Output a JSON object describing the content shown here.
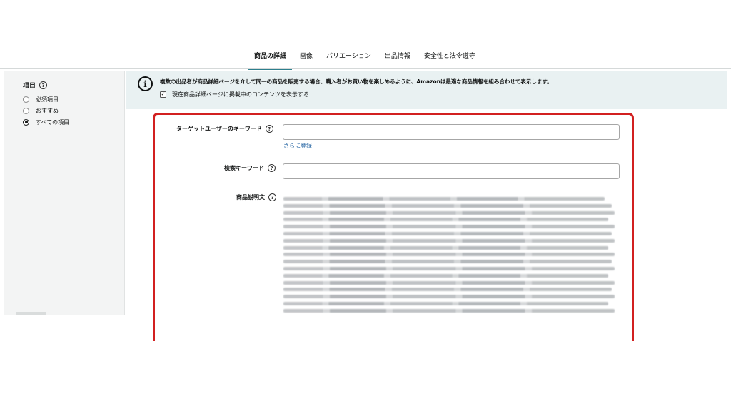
{
  "tabs": [
    {
      "label": "商品の詳細",
      "active": true
    },
    {
      "label": "画像",
      "active": false
    },
    {
      "label": "バリエーション",
      "active": false
    },
    {
      "label": "出品情報",
      "active": false
    },
    {
      "label": "安全性と法令遵守",
      "active": false
    }
  ],
  "sidebar": {
    "title": "項目",
    "options": [
      {
        "label": "必須項目",
        "checked": false
      },
      {
        "label": "おすすめ",
        "checked": false
      },
      {
        "label": "すべての項目",
        "checked": true
      }
    ]
  },
  "banner": {
    "message": "複数の出品者が商品詳細ページを介して同一の商品を販売する場合、購入者がお買い物を楽しめるように、Amazonは最適な商品情報を組み合わせて表示します。",
    "checkbox_label": "現在商品詳細ページに掲載中のコンテンツを表示する",
    "checkbox_checked": true
  },
  "form": {
    "target_keyword_label": "ターゲットユーザーのキーワード",
    "target_keyword_value": "",
    "add_more_link": "さらに登録",
    "search_keyword_label": "検索キーワード",
    "search_keyword_value": "",
    "description_label": "商品説明文"
  },
  "colors": {
    "accent": "#2d7f8d",
    "highlight_border": "#d22020",
    "banner_bg": "#e9f1f2",
    "link": "#2162a1"
  }
}
